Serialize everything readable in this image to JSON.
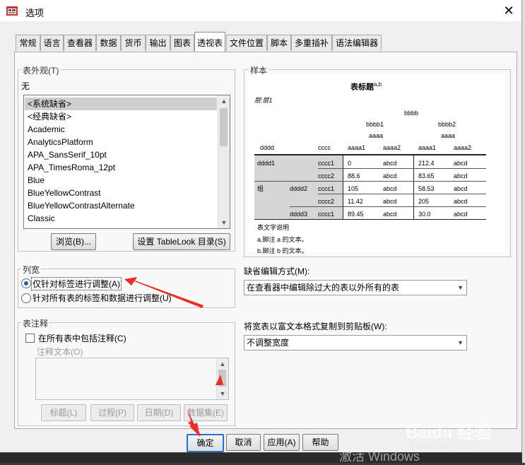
{
  "window": {
    "title": "选项",
    "close_glyph": "✕"
  },
  "tabs": [
    "常规",
    "语言",
    "查看器",
    "数据",
    "货币",
    "输出",
    "图表",
    "透视表",
    "文件位置",
    "脚本",
    "多重插补",
    "语法编辑器"
  ],
  "active_tab": "透视表",
  "appearance": {
    "legend": "表外观(T)",
    "current": "无",
    "items": [
      "<系统缺省>",
      "<经典缺省>",
      "Academic",
      "AnalyticsPlatform",
      "APA_SansSerif_10pt",
      "APA_TimesRoma_12pt",
      "Blue",
      "BlueYellowContrast",
      "BlueYellowContrastAlternate",
      "Classic"
    ],
    "selected_index": 0,
    "browse_button": "浏览(B)...",
    "set_dir_button": "设置 TableLook 目录(S)"
  },
  "sample": {
    "legend": "样本",
    "title": "表标题",
    "title_sup": "a,b",
    "layer": "层:层1",
    "col_header1": "bbbb",
    "col_sub": [
      "bbbb1",
      "bbbb2"
    ],
    "col_aaaa": "aaaa",
    "row_dim": "dddd",
    "row_dim2": "cccc",
    "leaf_cols": [
      "aaaa1",
      "aaaa2",
      "aaaa1",
      "aaaa2"
    ],
    "group_label": "组",
    "rows": [
      {
        "d1": "dddd1",
        "d2": "",
        "c": "cccc1",
        "v": [
          "0",
          "abcd",
          "212.4",
          "abcd"
        ]
      },
      {
        "d1": "",
        "d2": "",
        "c": "cccc2",
        "v": [
          "88.6",
          "abcd",
          "83.65",
          "abcd"
        ]
      },
      {
        "d1": "",
        "d2": "dddd2",
        "c": "cccc1",
        "v": [
          "105",
          "abcd",
          "58.53",
          "abcd"
        ]
      },
      {
        "d1": "",
        "d2": "",
        "c": "cccc2",
        "v": [
          "11.42",
          "abcd",
          "205",
          "abcd"
        ]
      },
      {
        "d1": "",
        "d2": "dddd3",
        "c": "cccc1",
        "v": [
          "89.45",
          "abcd",
          "30.0",
          "abcd"
        ]
      }
    ],
    "caption": "表文字说明",
    "note_a": "a.脚注 a 的文本。",
    "note_b": "b.脚注 b 的文本。"
  },
  "column_width": {
    "legend": "列宽",
    "options": [
      "仅针对标签进行调整(A)",
      "针对所有表的标签和数据进行调整(U)"
    ],
    "selected_index": 0
  },
  "default_edit": {
    "label": "缺省编辑方式(M):",
    "value": "在查看器中编辑除过大的表以外所有的表"
  },
  "copy_rtf": {
    "label": "将宽表以富文本格式复制到剪贴板(W):",
    "value": "不调整宽度"
  },
  "comments": {
    "legend": "表注释",
    "checkbox_label": "在所有表中包括注释(C)",
    "checked": false,
    "text_label": "注释文本(O)",
    "buttons": [
      "标题(L)",
      "过程(P)",
      "日期(D)",
      "数据集(E)"
    ]
  },
  "footer": {
    "ok": "确定",
    "cancel": "取消",
    "apply": "应用(A)",
    "help": "帮助"
  },
  "watermark": {
    "activate": "激活 Windows",
    "site": "jingyan.baidu.com",
    "logo": "Baidu 经验"
  },
  "colors": {
    "annotation_arrow": "#e8302a",
    "radio_dot": "#1e5db0"
  }
}
